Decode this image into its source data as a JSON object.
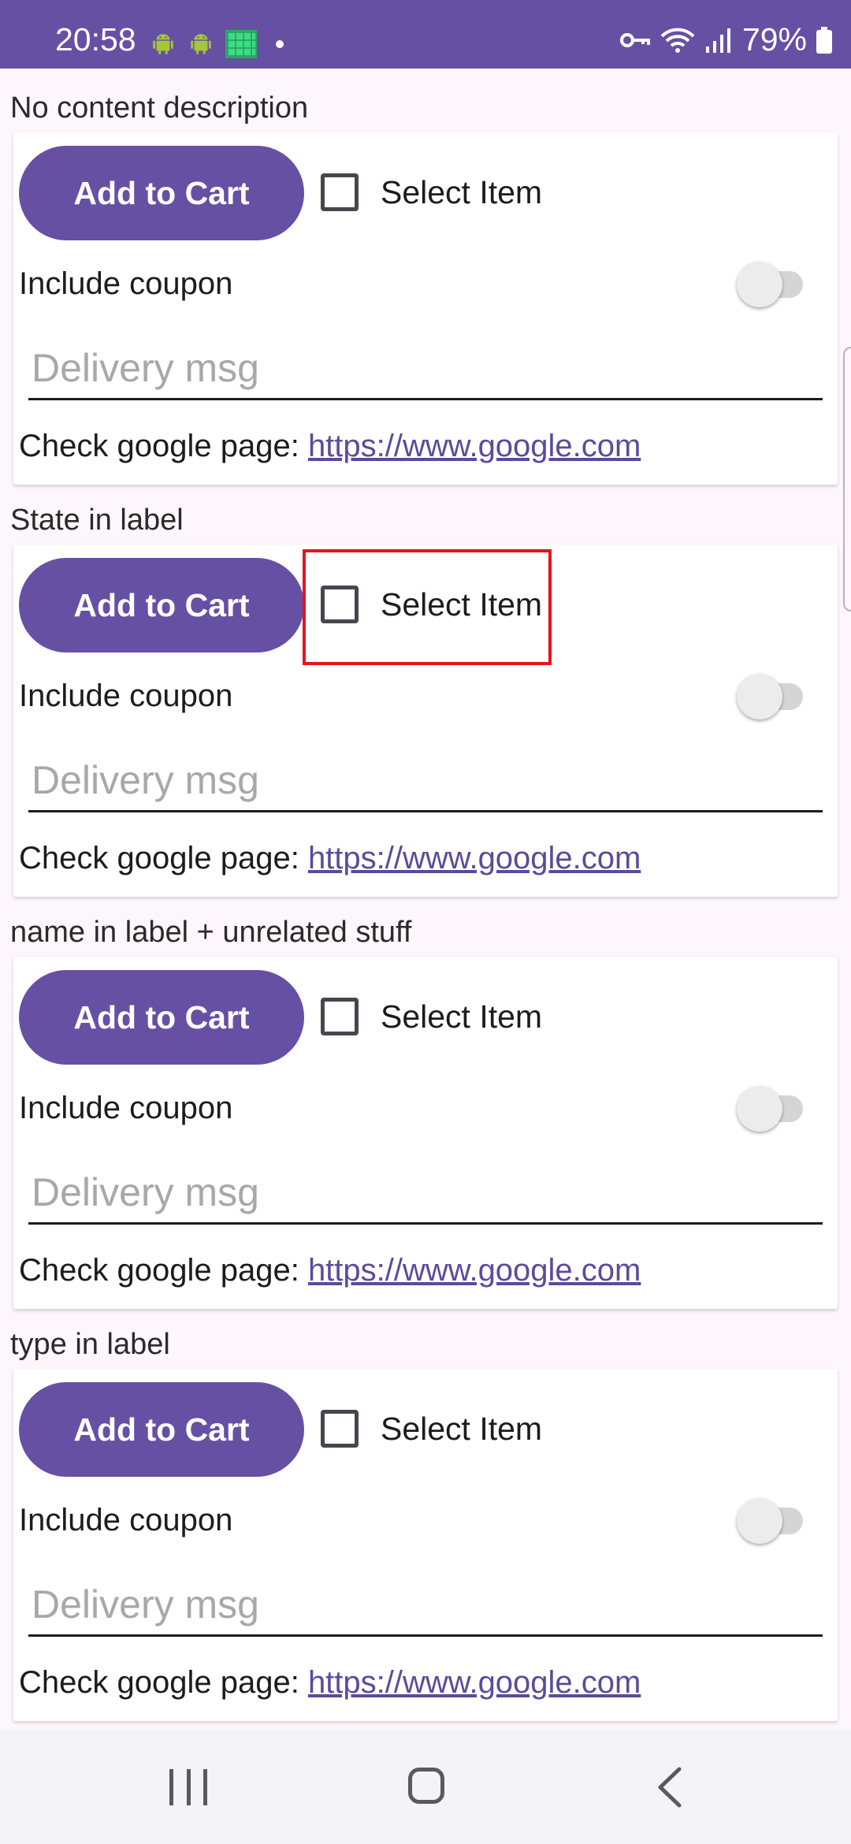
{
  "status_bar": {
    "time": "20:58",
    "battery": "79%",
    "icons": [
      "android-icon",
      "android-icon",
      "spreadsheet-icon",
      "dot-icon",
      "vpn-key-icon",
      "wifi-icon",
      "signal-icon",
      "battery-icon"
    ]
  },
  "colors": {
    "accent": "#6650a4",
    "highlight": "#e8131c",
    "link": "#5b4b9a"
  },
  "sections": [
    {
      "title": "No content description",
      "cart_button": "Add to Cart",
      "checkbox_label": "Select Item",
      "checkbox_checked": false,
      "coupon_label": "Include coupon",
      "coupon_on": false,
      "delivery_placeholder": "Delivery msg",
      "google_prefix": "Check google page: ",
      "google_link": "https://www.google.com"
    },
    {
      "title": "State in label",
      "cart_button": "Add to Cart",
      "checkbox_label": "Select Item",
      "checkbox_checked": false,
      "coupon_label": "Include coupon",
      "coupon_on": false,
      "delivery_placeholder": "Delivery msg",
      "google_prefix": "Check google page: ",
      "google_link": "https://www.google.com"
    },
    {
      "title": "name in label + unrelated stuff",
      "cart_button": "Add to Cart",
      "checkbox_label": "Select Item",
      "checkbox_checked": false,
      "coupon_label": "Include coupon",
      "coupon_on": false,
      "delivery_placeholder": "Delivery msg",
      "google_prefix": "Check google page: ",
      "google_link": "https://www.google.com"
    },
    {
      "title": "type in label",
      "cart_button": "Add to Cart",
      "checkbox_label": "Select Item",
      "checkbox_checked": false,
      "coupon_label": "Include coupon",
      "coupon_on": false,
      "delivery_placeholder": "Delivery msg",
      "google_prefix": "Check google page: ",
      "google_link": "https://www.google.com"
    }
  ],
  "nav_bar": {
    "icons": [
      "recent-apps-icon",
      "home-icon",
      "back-icon"
    ]
  }
}
